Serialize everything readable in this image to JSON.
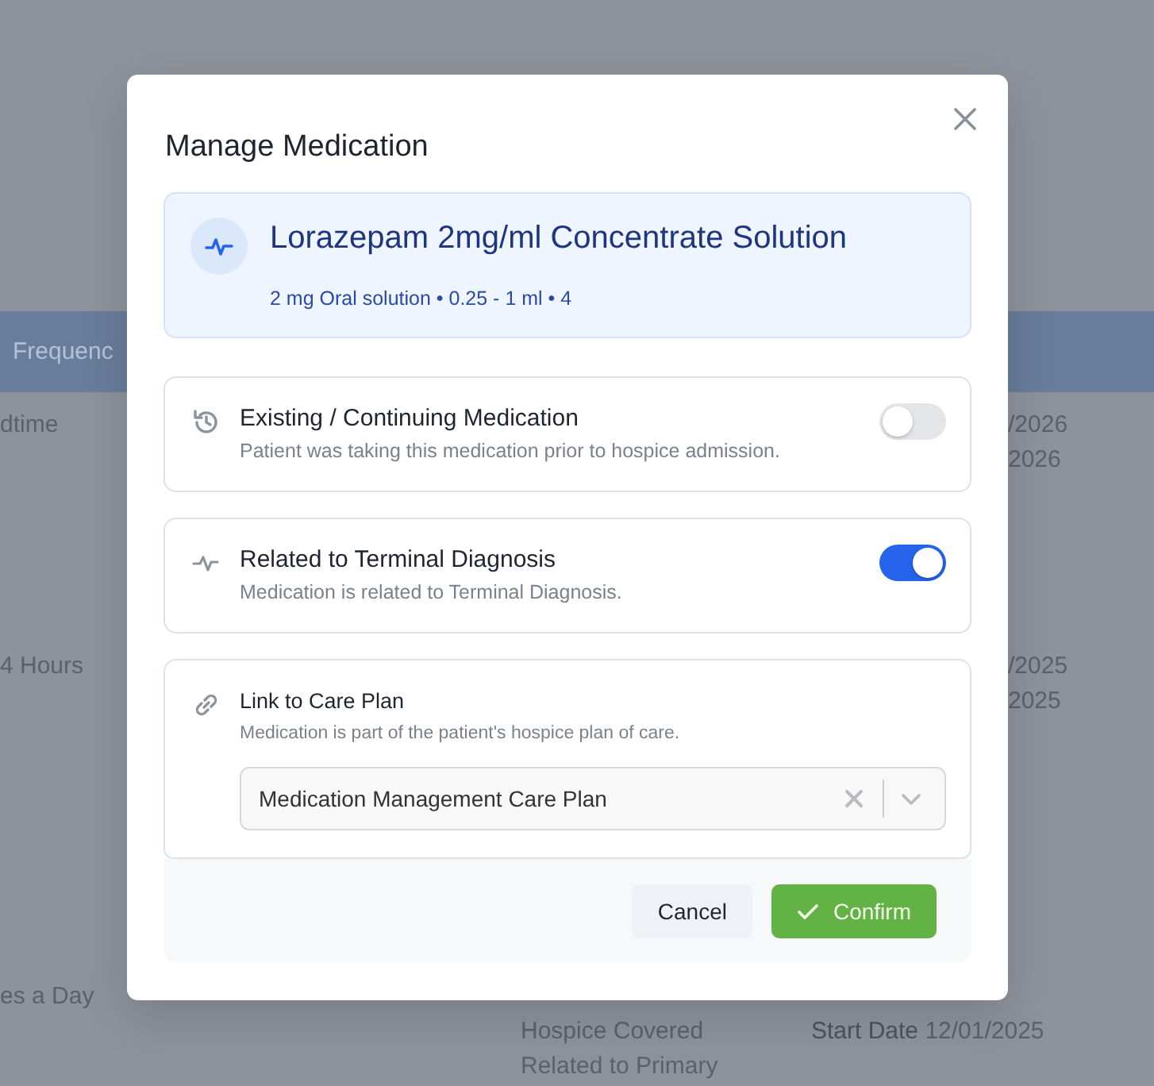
{
  "background_table": {
    "header": {
      "column_1": "Frequenc"
    },
    "rows": [
      {
        "column_1": "dtime",
        "column_4": [
          "/2026",
          "2026"
        ]
      },
      {
        "column_1": "4 Hours",
        "column_4": [
          "/2025",
          "2025"
        ]
      },
      {
        "column_1": "es a Day",
        "column_3": [
          "Hospice Covered",
          "Related to Primary"
        ],
        "column_4": [
          "**Start Date** 12/01/2025"
        ]
      }
    ]
  },
  "dialog": {
    "title": "Manage Medication",
    "medication": {
      "name": "Lorazepam 2mg/ml Concentrate Solution",
      "details": "2 mg Oral solution • 0.25 - 1 ml • 4"
    },
    "options": [
      {
        "kind": "toggle",
        "title": "Existing / Continuing Medication",
        "description": "Patient was taking this medication prior to hospice admission.",
        "on": false
      },
      {
        "kind": "toggle",
        "title": "Related to Terminal Diagnosis",
        "description": "Medication is related to Terminal Diagnosis.",
        "on": true
      },
      {
        "kind": "select",
        "title": "Link to Care Plan",
        "description": "Medication is part of the patient's hospice plan of care.",
        "value": "Medication Management Care Plan"
      }
    ],
    "buttons": [
      {
        "kind": "secondary",
        "label": "Cancel"
      },
      {
        "kind": "primary",
        "label": "Confirm"
      }
    ]
  }
}
